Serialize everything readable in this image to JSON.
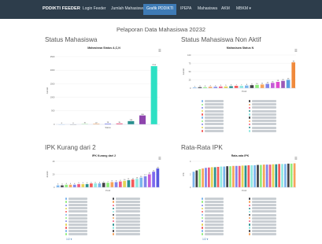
{
  "navbar": {
    "brand": "PDDIKTI FEEDER",
    "items": [
      {
        "label": "Login Feeder",
        "active": false
      },
      {
        "label": "Jumlah Mahasiswa",
        "active": false
      },
      {
        "label": "Grafik PDDIKTI",
        "active": true
      },
      {
        "label": "IPEPA",
        "active": false
      },
      {
        "label": "Mahasiswa",
        "active": false
      },
      {
        "label": "AKM",
        "active": false
      },
      {
        "label": "MBKM ▾",
        "active": false
      }
    ]
  },
  "page_title": "Pelaporan Data Mahasiswa 20232",
  "accent_color": "#3e7bb6",
  "chart_data": [
    {
      "card_title": "Status Mahasiswa",
      "title": "Mahasiswa Status A,C,N",
      "type": "bar",
      "categories": [
        "1",
        "2",
        "3",
        "4",
        "5",
        "6",
        "7",
        "8",
        "9"
      ],
      "values": [
        0,
        0,
        15,
        22,
        28,
        35,
        120,
        330,
        2150
      ],
      "colors": [
        "#7cb5ec",
        "#434348",
        "#90ed7d",
        "#f7a35c",
        "#8085e9",
        "#f15c80",
        "#2b908f",
        "#8e44ad",
        "#2ee0c4"
      ],
      "ylabel": "Jumlah",
      "xlabel": "Status",
      "ylim": [
        0,
        2500
      ],
      "yticks": [
        "2500",
        "2000",
        "1500",
        "1000",
        "500",
        "0"
      ],
      "grid": true
    },
    {
      "card_title": "Status Mahasiswa Non Aktif",
      "title": "Mahasiswa Status N",
      "type": "bar",
      "ylabel": "Jumlah",
      "xlabel": "Prodi",
      "ylim": [
        0,
        100
      ],
      "yticks": [
        "100",
        "75",
        "50",
        "25",
        "0"
      ],
      "values": [
        2,
        3,
        3,
        4,
        4,
        5,
        5,
        6,
        7,
        7,
        8,
        9,
        10,
        11,
        13,
        16,
        19,
        22,
        25,
        78
      ],
      "colors": [
        "#7cb5ec",
        "#434348",
        "#90ed7d",
        "#f7a35c",
        "#8085e9",
        "#f15c80",
        "#e4d354",
        "#2b908f",
        "#f45b5b",
        "#91e8e1",
        "#7cb5ec",
        "#434348",
        "#90ed7d",
        "#f7a35c",
        "#8085e9",
        "#c45bd6",
        "#e04ad0",
        "#9b59b6",
        "#5aa0e0",
        "#f08a3c"
      ],
      "grid": true
    },
    {
      "card_title": "IPK Kurang dari 2",
      "title": "IPK Kurang dari 2",
      "type": "bar",
      "ylabel": "Jumlah",
      "xlabel": "Prodi",
      "ylim": [
        0,
        40
      ],
      "yticks": [
        "40",
        "20",
        "0"
      ],
      "values": [
        3,
        3,
        4,
        4,
        4,
        5,
        5,
        5,
        6,
        6,
        6,
        7,
        7,
        8,
        8,
        9,
        10,
        11,
        12,
        13,
        15,
        17,
        20,
        24,
        29
      ],
      "colors": [
        "#7cb5ec",
        "#434348",
        "#90ed7d",
        "#f7a35c",
        "#8085e9",
        "#f15c80",
        "#e4d354",
        "#2b908f",
        "#f45b5b",
        "#91e8e1",
        "#7cb5ec",
        "#434348",
        "#90ed7d",
        "#f7a35c",
        "#8085e9",
        "#f15c80",
        "#e4d354",
        "#2b908f",
        "#f45b5b",
        "#91e8e1",
        "#7cb5ec",
        "#8085e9",
        "#c45bd6",
        "#7b68ee",
        "#5a5ae0"
      ],
      "grid": true
    },
    {
      "card_title": "Rata-Rata IPK",
      "title": "Rata-rata IPK",
      "type": "bar",
      "ylabel": "IPK",
      "xlabel": "Prodi",
      "ylim": [
        0,
        4
      ],
      "yticks": [
        "4",
        "2",
        "0"
      ],
      "values": [
        2.4,
        2.6,
        2.8,
        2.9,
        3.0,
        3.05,
        3.1,
        3.1,
        3.15,
        3.2,
        3.2,
        3.25,
        3.25,
        3.3,
        3.3,
        3.3,
        3.35,
        3.35,
        3.4,
        3.4,
        3.4,
        3.45,
        3.45,
        3.5,
        3.5,
        3.5,
        3.55,
        3.55,
        3.6,
        3.6,
        3.6,
        3.65,
        3.65,
        3.7
      ],
      "colors": [
        "#7cb5ec",
        "#434348",
        "#90ed7d",
        "#f7a35c",
        "#8085e9",
        "#f15c80",
        "#e4d354",
        "#2b908f",
        "#f45b5b",
        "#91e8e1"
      ],
      "grid": true
    }
  ],
  "legends": [
    {
      "count": 9,
      "colors": [
        "#7cb5ec",
        "#434348",
        "#90ed7d",
        "#f7a35c",
        "#8085e9",
        "#f15c80",
        "#2b908f",
        "#8e44ad",
        "#2ee0c4"
      ]
    },
    {
      "count": 20,
      "colors": [
        "#7cb5ec",
        "#434348",
        "#90ed7d",
        "#f7a35c",
        "#8085e9",
        "#f15c80",
        "#e4d354",
        "#2b908f",
        "#f45b5b",
        "#91e8e1"
      ]
    },
    {
      "count": 24,
      "colors": [
        "#7cb5ec",
        "#434348",
        "#90ed7d",
        "#f7a35c",
        "#8085e9",
        "#f15c80",
        "#e4d354",
        "#2b908f",
        "#f45b5b",
        "#91e8e1"
      ]
    },
    {
      "count": 24,
      "colors": [
        "#7cb5ec",
        "#434348",
        "#90ed7d",
        "#f7a35c",
        "#8085e9",
        "#f15c80",
        "#e4d354",
        "#2b908f",
        "#f45b5b",
        "#91e8e1"
      ]
    }
  ],
  "pager": [
    "1/2 ▾",
    "1/2 ▾"
  ],
  "menu_icon": "≡",
  "icons": [
    "hamburger-menu-icon"
  ]
}
